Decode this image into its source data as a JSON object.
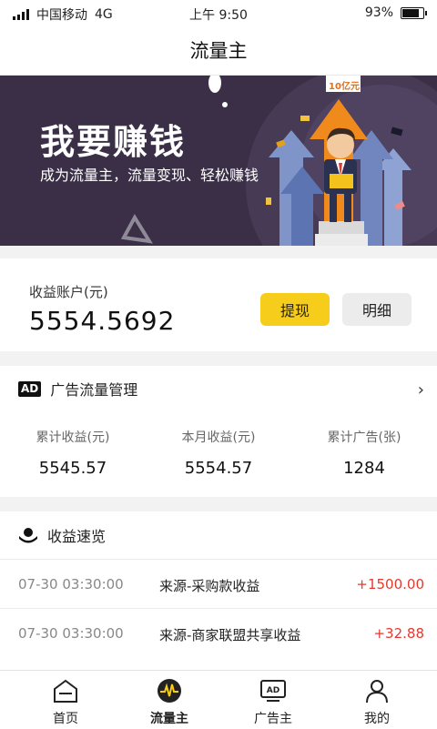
{
  "status_bar": {
    "carrier": "中国移动",
    "network": "4G",
    "time": "上午 9:50",
    "battery_text": "93%",
    "battery_level": 0.93
  },
  "header": {
    "title": "流量主"
  },
  "banner": {
    "headline": "我要赚钱",
    "subtitle": "成为流量主，流量变现、轻松赚钱",
    "sign_text": "10亿元"
  },
  "account": {
    "label": "收益账户(元)",
    "balance": "5554.5692",
    "withdraw_label": "提现",
    "detail_label": "明细"
  },
  "ad_management": {
    "badge": "AD",
    "title": "广告流量管理",
    "stats": [
      {
        "label": "累计收益(元)",
        "value": "5545.57"
      },
      {
        "label": "本月收益(元)",
        "value": "5554.57"
      },
      {
        "label": "累计广告(张)",
        "value": "1284"
      }
    ]
  },
  "income_overview": {
    "title": "收益速览",
    "items": [
      {
        "time": "07-30 03:30:00",
        "source": "来源-采购款收益",
        "amount": "+1500.00"
      },
      {
        "time": "07-30 03:30:00",
        "source": "来源-商家联盟共享收益",
        "amount": "+32.88"
      }
    ]
  },
  "tabbar": {
    "active_index": 1,
    "items": [
      {
        "label": "首页",
        "icon": "home-icon"
      },
      {
        "label": "流量主",
        "icon": "pulse-icon"
      },
      {
        "label": "广告主",
        "icon": "ad-icon"
      },
      {
        "label": "我的",
        "icon": "user-icon"
      }
    ],
    "ad_icon_text": "AD"
  },
  "colors": {
    "accent": "#f7cd1c",
    "banner_bg": "#3a2f46",
    "income": "#e23a2e"
  }
}
